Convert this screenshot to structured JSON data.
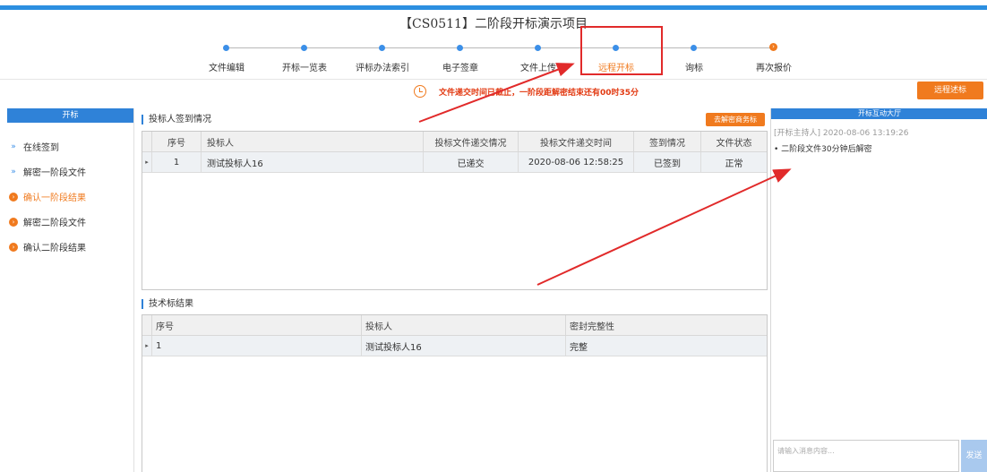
{
  "header": {
    "title": "【CS0511】二阶段开标演示项目"
  },
  "steps": [
    {
      "label": "文件编辑",
      "state": "done"
    },
    {
      "label": "开标一览表",
      "state": "done"
    },
    {
      "label": "评标办法索引",
      "state": "done"
    },
    {
      "label": "电子签章",
      "state": "done"
    },
    {
      "label": "文件上传",
      "state": "done"
    },
    {
      "label": "远程开标",
      "state": "active"
    },
    {
      "label": "询标",
      "state": "done"
    },
    {
      "label": "再次报价",
      "state": "current"
    }
  ],
  "notice": {
    "text": "文件递交时间已截止，一阶段距解密结束还有00时35分"
  },
  "toolbar": {
    "remote_bid_label": "远程述标"
  },
  "left_panel": {
    "title": "开标",
    "items": [
      {
        "label": "在线签到",
        "icon": "chevron-right-icon",
        "active": false
      },
      {
        "label": "解密一阶段文件",
        "icon": "chevron-right-icon",
        "active": false
      },
      {
        "label": "确认一阶段结果",
        "icon": "orange-circle-arrow-icon",
        "active": true
      },
      {
        "label": "解密二阶段文件",
        "icon": "orange-circle-arrow-icon",
        "active": false
      },
      {
        "label": "确认二阶段结果",
        "icon": "orange-circle-arrow-icon",
        "active": false
      }
    ]
  },
  "signin_section": {
    "title": "投标人签到情况",
    "decrypt_button": "去解密商务标",
    "columns": [
      "序号",
      "投标人",
      "投标文件递交情况",
      "投标文件递交时间",
      "签到情况",
      "文件状态"
    ],
    "rows": [
      [
        "1",
        "测试投标人16",
        "已递交",
        "2020-08-06 12:58:25",
        "已签到",
        "正常"
      ]
    ]
  },
  "tech_section": {
    "title": "技术标结果",
    "columns": [
      "序号",
      "投标人",
      "密封完整性"
    ],
    "rows": [
      [
        "1",
        "测试投标人16",
        "完整"
      ]
    ]
  },
  "chat": {
    "title": "开标互动大厅",
    "meta": "[开标主持人] 2020-08-06 13:19:26",
    "message": "• 二阶段文件30分钟后解密",
    "input_placeholder": "请输入消息内容...",
    "send_label": "发送"
  }
}
